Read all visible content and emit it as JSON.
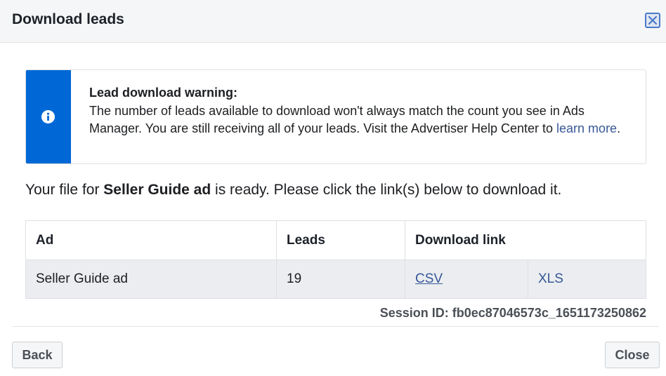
{
  "dialog": {
    "title": "Download leads"
  },
  "warning": {
    "title": "Lead download warning:",
    "body": "The number of leads available to download won't always match the count you see in Ads Manager. You are still receiving all of your leads. Visit the Advertiser Help Center to ",
    "link_text": "learn more",
    "suffix": ".",
    "accent_color": "#0068d6"
  },
  "message": {
    "prefix": "Your file for ",
    "ad_name": "Seller Guide ad",
    "suffix": " is ready. Please click the link(s) below to download it."
  },
  "table": {
    "headers": [
      "Ad",
      "Leads",
      "Download link"
    ],
    "rows": [
      {
        "ad": "Seller Guide ad",
        "leads": "19",
        "csv": "CSV",
        "xls": "XLS"
      }
    ]
  },
  "session": {
    "text": "Session ID: fb0ec87046573c_1651173250862"
  },
  "footer": {
    "back_label": "Back",
    "close_label": "Close"
  },
  "colors": {
    "link": "#385898",
    "header_bg": "#f5f6f7",
    "row_bg": "#ebedf0"
  }
}
